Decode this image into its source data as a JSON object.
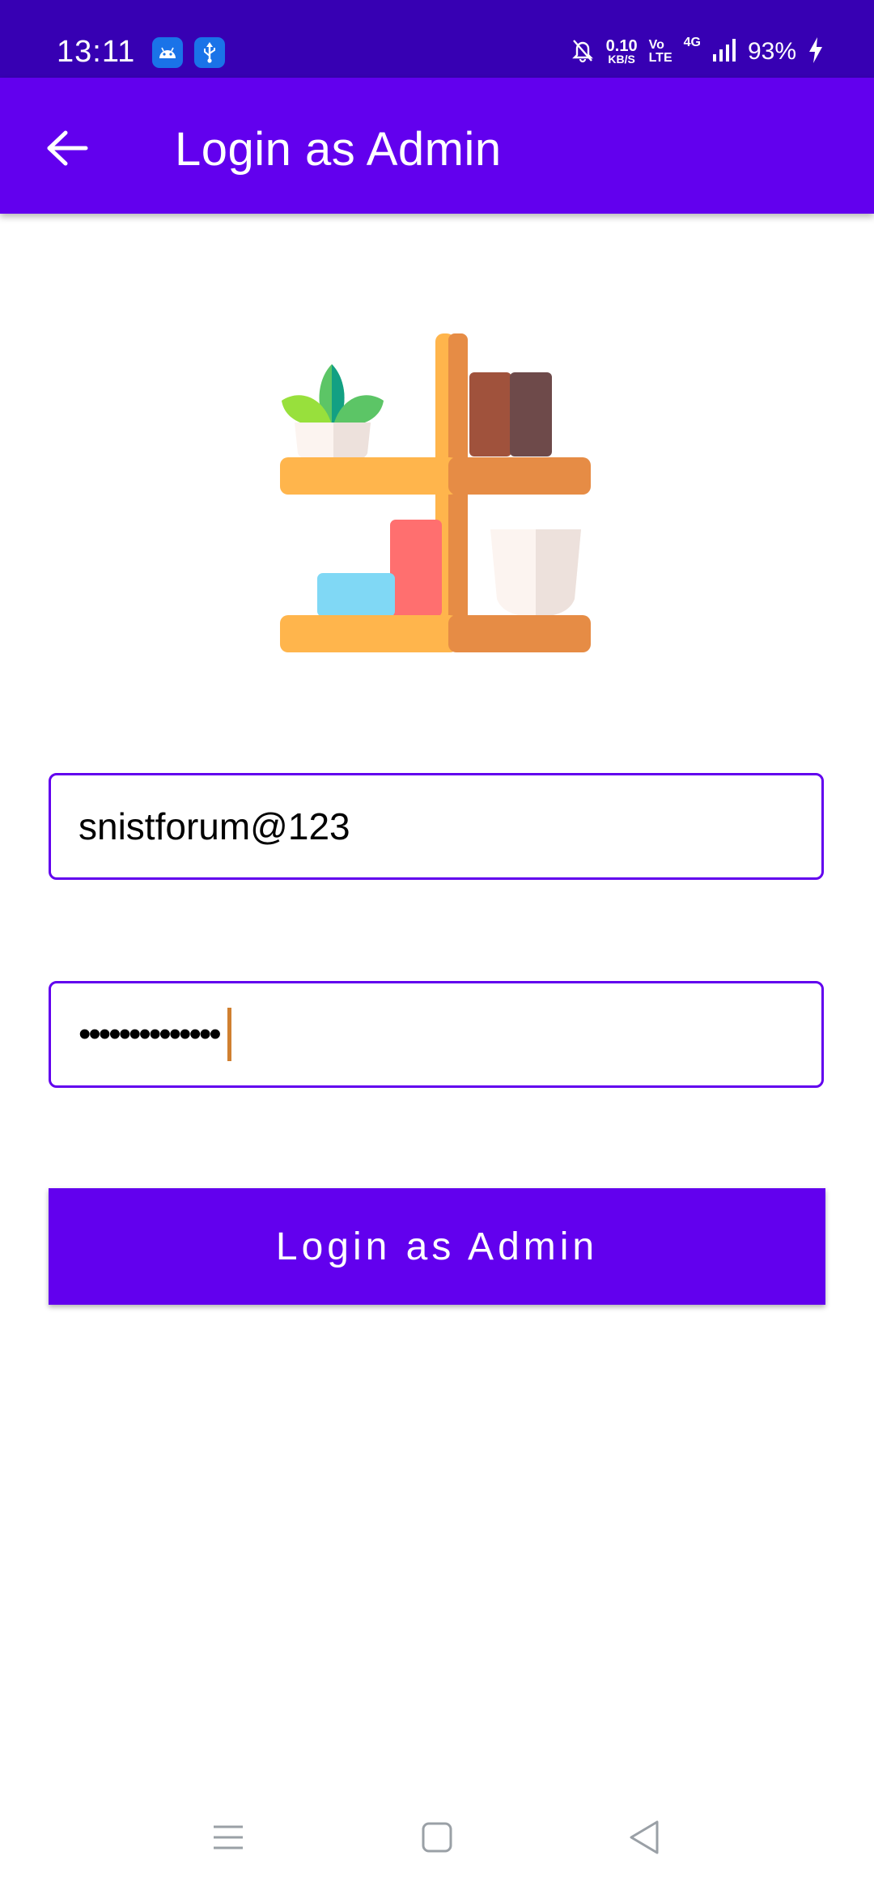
{
  "status_bar": {
    "time": "13:11",
    "net_speed_value": "0.10",
    "net_speed_unit": "KB/S",
    "volte_top": "Vo",
    "volte_bottom": "LTE",
    "network": "4G",
    "battery": "93%",
    "icons": [
      "android-icon",
      "usb-icon",
      "bell-off-icon",
      "signal-icon",
      "charging-icon"
    ]
  },
  "app_bar": {
    "title": "Login as Admin",
    "back_icon": "arrow-left-icon"
  },
  "form": {
    "email_value": "snistforum@123",
    "password_masked": "••••••••••••••",
    "submit_label": "Login as Admin"
  },
  "colors": {
    "status_bar": "#3700b3",
    "primary": "#6200ee",
    "caret": "#d08030"
  },
  "nav_bar": {
    "icons": [
      "menu-icon",
      "home-icon",
      "back-triangle-icon"
    ]
  }
}
